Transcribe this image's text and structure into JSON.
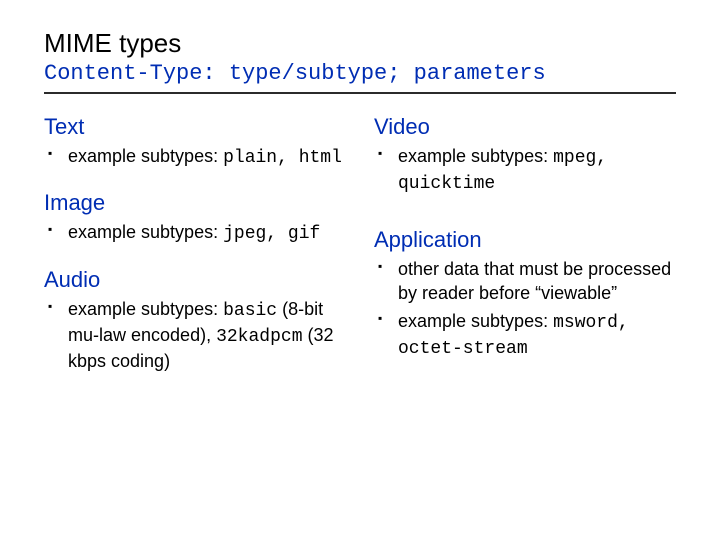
{
  "title": "MIME types",
  "subtitle": "Content-Type: type/subtype; parameters",
  "left": {
    "text": {
      "heading": "Text",
      "item_prefix": "example subtypes: ",
      "item_code": "plain, html"
    },
    "image": {
      "heading": "Image",
      "item_prefix": "example subtypes: ",
      "item_code": "jpeg, gif"
    },
    "audio": {
      "heading": "Audio",
      "item_prefix": "example subtypes: ",
      "item_code1": "basic",
      "item_mid1": " (8-bit mu-law encoded), ",
      "item_code2": "32kadpcm",
      "item_tail": " (32 kbps coding)"
    }
  },
  "right": {
    "video": {
      "heading": "Video",
      "item_prefix": "example subtypes: ",
      "item_code": "mpeg, quicktime"
    },
    "application": {
      "heading": "Application",
      "item1": "other data that must be processed by reader before “viewable”",
      "item2_prefix": "example subtypes: ",
      "item2_code": "msword, octet-stream"
    }
  }
}
